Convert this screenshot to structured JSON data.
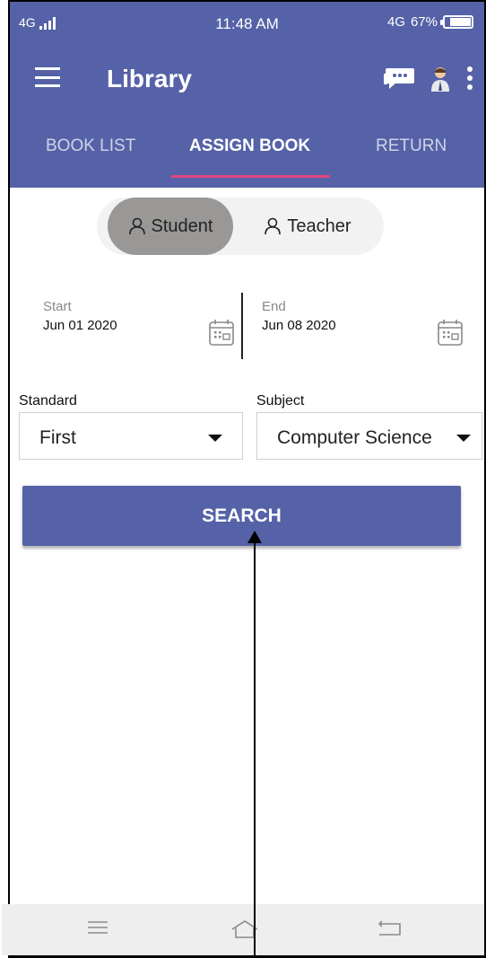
{
  "status_bar": {
    "network_left": "4G",
    "time": "11:48 AM",
    "network_right": "4G",
    "battery": "67%"
  },
  "toolbar": {
    "title": "Library",
    "icons": [
      "chat-icon",
      "teacher-icon",
      "more-vert-icon"
    ]
  },
  "tabs": [
    {
      "label": "BOOK LIST",
      "active": false
    },
    {
      "label": "ASSIGN BOOK",
      "active": true
    },
    {
      "label": "RETURN",
      "active": false
    }
  ],
  "toggle": {
    "options": [
      {
        "label": "Student",
        "selected": true
      },
      {
        "label": "Teacher",
        "selected": false
      }
    ]
  },
  "dates": {
    "start_label": "Start",
    "start_value": "Jun 01 2020",
    "end_label": "End",
    "end_value": "Jun 08 2020"
  },
  "filters": {
    "standard_label": "Standard",
    "standard_value": "First",
    "subject_label": "Subject",
    "subject_value": "Computer Science"
  },
  "search_button": "SEARCH",
  "nav_bar": {
    "icons": [
      "menu-icon",
      "home-icon",
      "back-icon"
    ]
  },
  "colors": {
    "primary": "#5562a7",
    "tab_indicator": "#e0457f",
    "selected_toggle": "#9a9896"
  }
}
